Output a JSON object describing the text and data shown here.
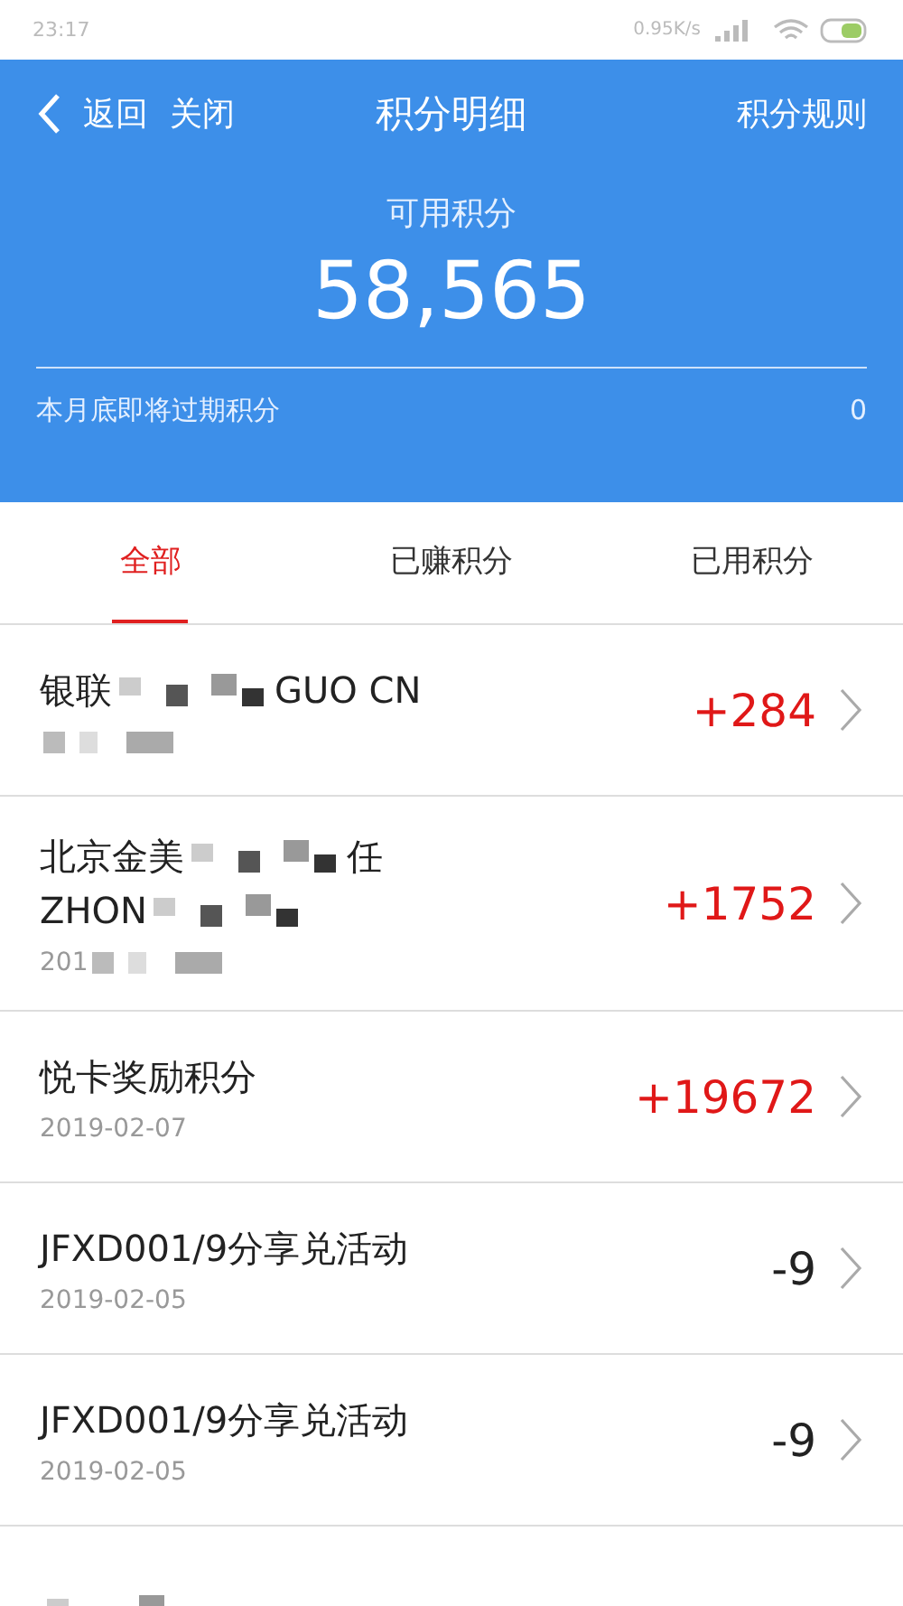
{
  "status_bar": {
    "time": "23:17",
    "speed": "0.95K/s"
  },
  "nav": {
    "back": "返回",
    "close": "关闭",
    "title": "积分明细",
    "rules": "积分规则"
  },
  "balance": {
    "label": "可用积分",
    "value": "58,565"
  },
  "expiring": {
    "label": "本月底即将过期积分",
    "value": "0"
  },
  "tabs": [
    {
      "label": "全部",
      "selected": true
    },
    {
      "label": "已赚积分",
      "selected": false
    },
    {
      "label": "已用积分",
      "selected": false
    }
  ],
  "records": [
    {
      "title_lines": [
        [
          {
            "kind": "text",
            "text": "银联"
          },
          {
            "kind": "redacted"
          },
          {
            "kind": "text",
            "text": "GUO CN"
          }
        ]
      ],
      "date": [
        {
          "kind": "redacted"
        }
      ],
      "amount": "+284",
      "color": "#e01818"
    },
    {
      "title_lines": [
        [
          {
            "kind": "text",
            "text": "北京金美"
          },
          {
            "kind": "redacted"
          },
          {
            "kind": "text",
            "text": "任"
          }
        ],
        [
          {
            "kind": "text",
            "text": "ZHON"
          },
          {
            "kind": "redacted"
          }
        ]
      ],
      "date": [
        {
          "kind": "text",
          "text": "201"
        },
        {
          "kind": "redacted"
        }
      ],
      "amount": "+1752",
      "color": "#e01818"
    },
    {
      "title_lines": [
        [
          {
            "kind": "text",
            "text": "悦卡奖励积分"
          }
        ]
      ],
      "date": [
        {
          "kind": "text",
          "text": "2019-02-07"
        }
      ],
      "amount": "+19672",
      "color": "#e01818"
    },
    {
      "title_lines": [
        [
          {
            "kind": "text",
            "text": "JFXD001/9分享兑活动"
          }
        ]
      ],
      "date": [
        {
          "kind": "text",
          "text": "2019-02-05"
        }
      ],
      "amount": "-9",
      "color": "#222222"
    },
    {
      "title_lines": [
        [
          {
            "kind": "text",
            "text": "JFXD001/9分享兑活动"
          }
        ]
      ],
      "date": [
        {
          "kind": "text",
          "text": "2019-02-05"
        }
      ],
      "amount": "-9",
      "color": "#222222"
    },
    {
      "title_lines": [
        [
          {
            "kind": "redacted"
          }
        ]
      ]
    }
  ]
}
